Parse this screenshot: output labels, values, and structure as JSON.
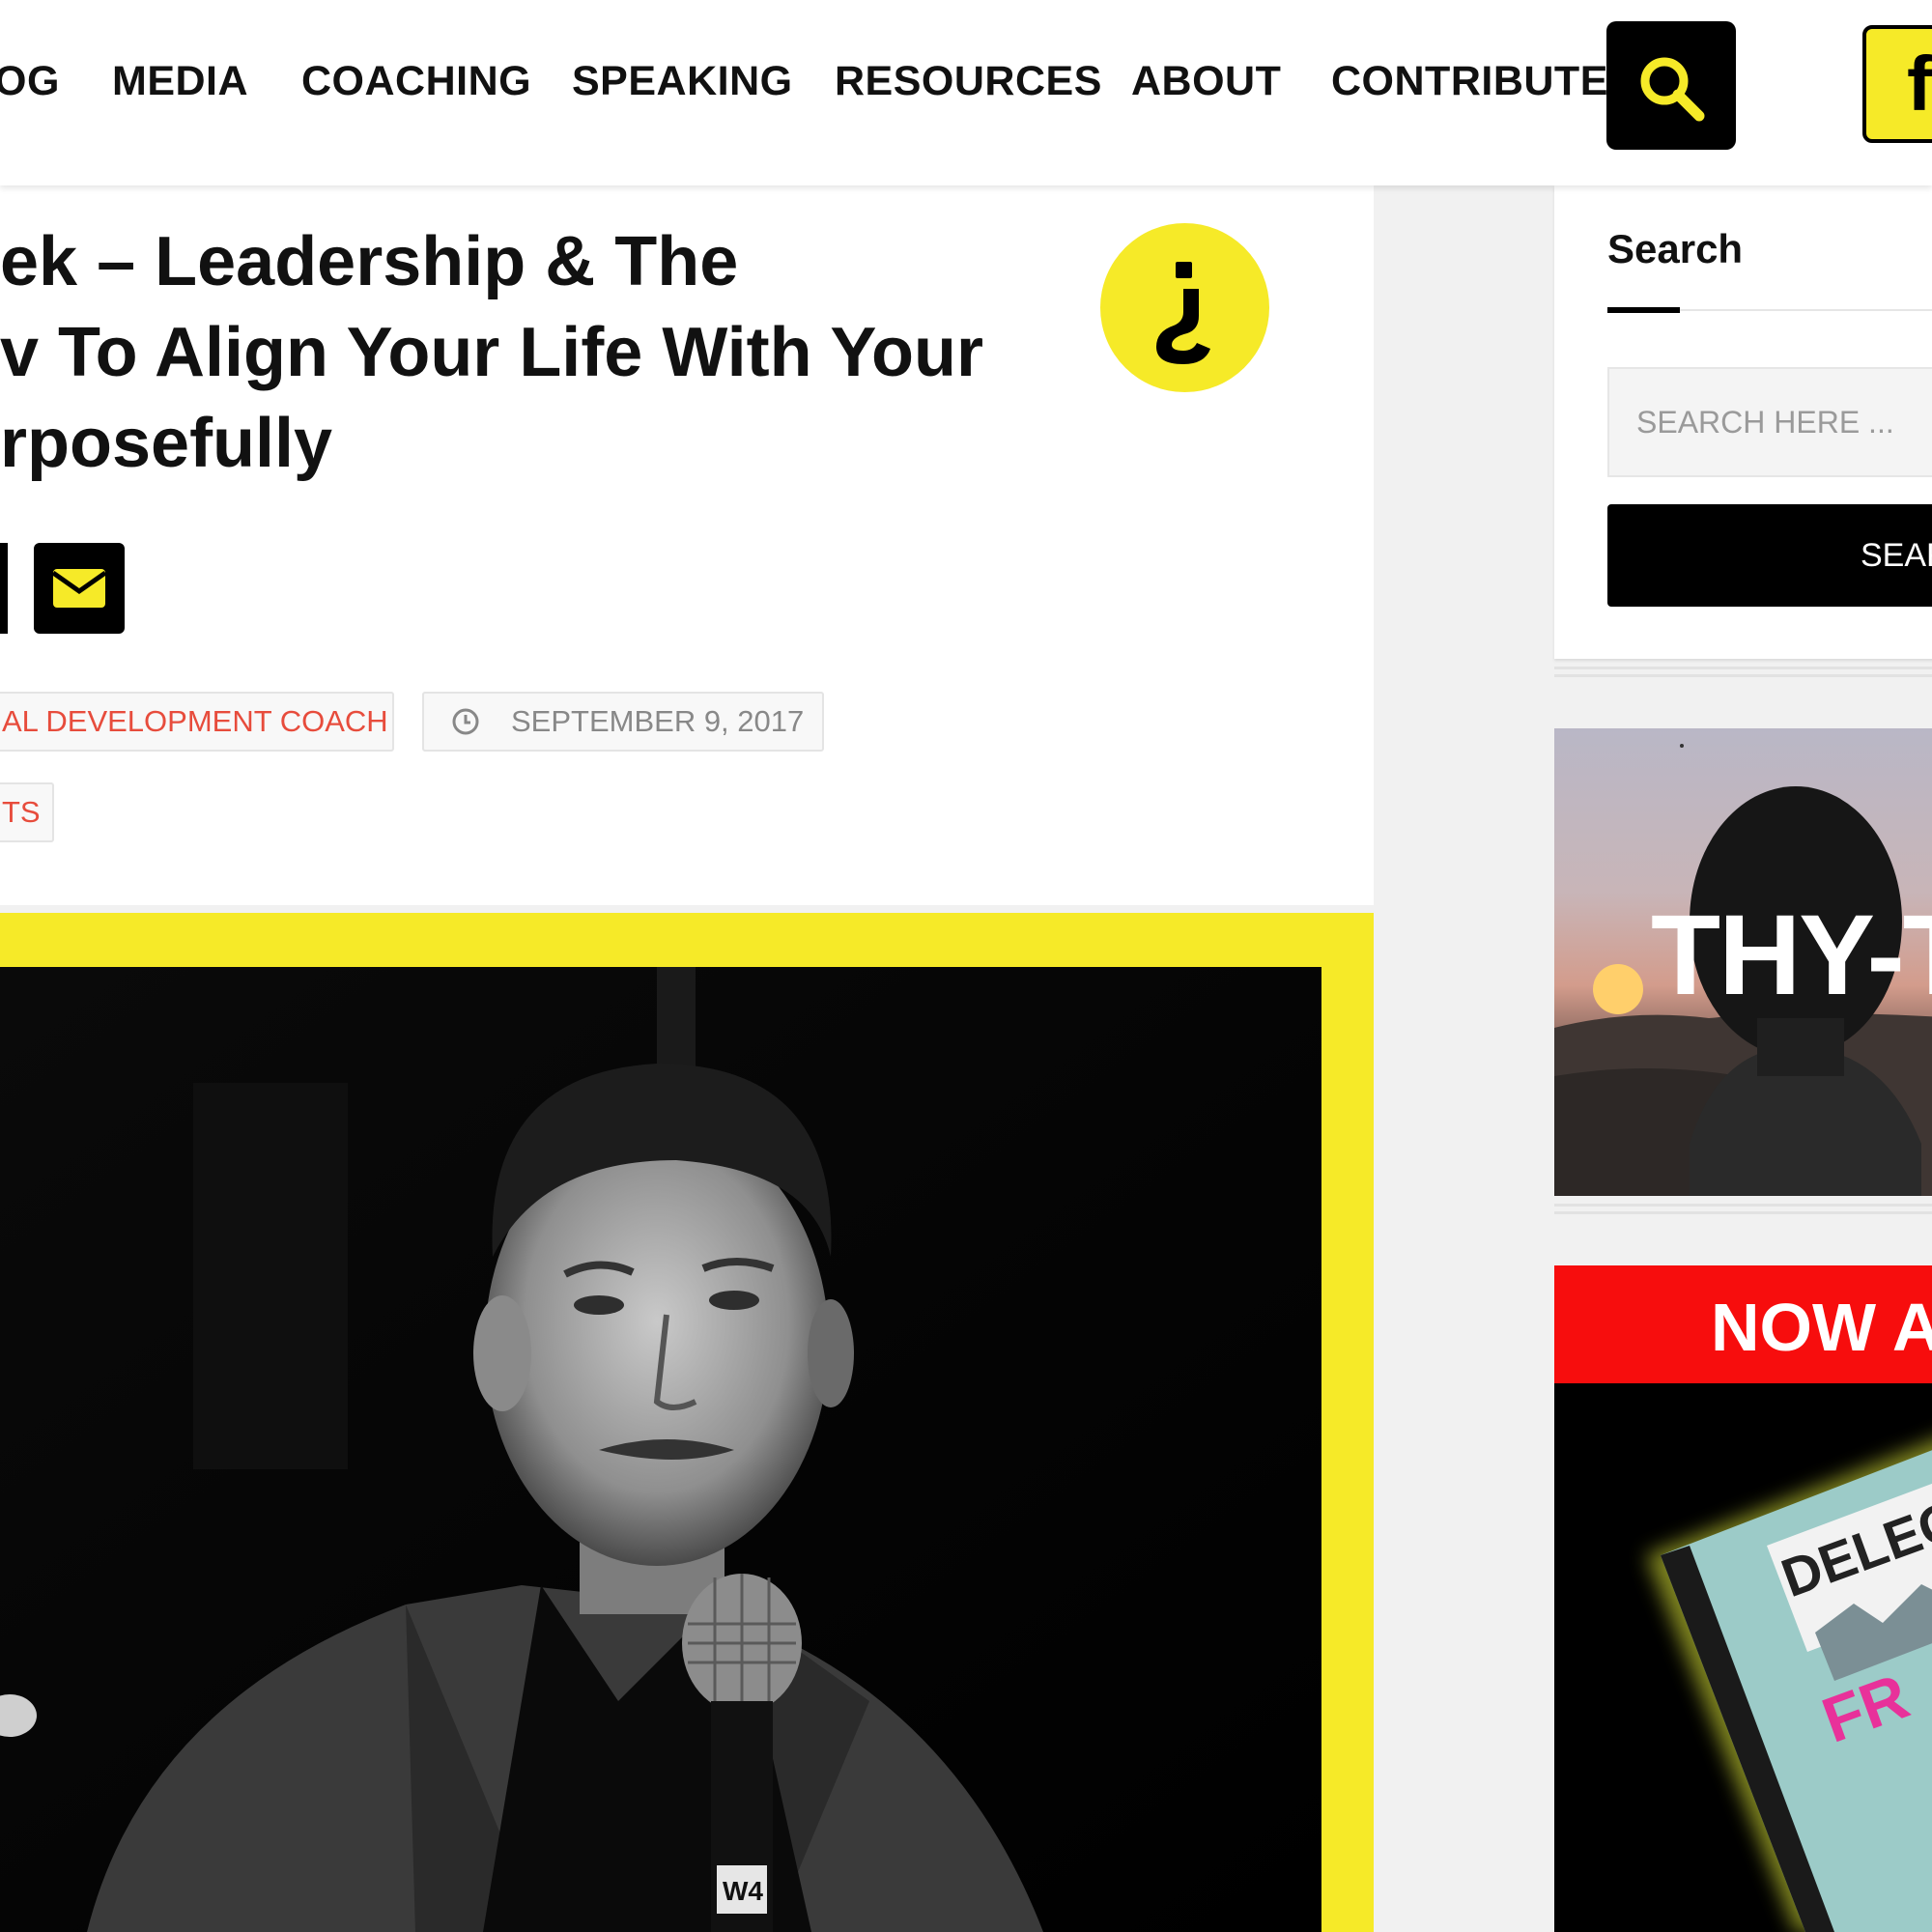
{
  "nav": {
    "items": [
      {
        "label": "OG"
      },
      {
        "label": "MEDIA"
      },
      {
        "label": "COACHING"
      },
      {
        "label": "SPEAKING"
      },
      {
        "label": "RESOURCES"
      },
      {
        "label": "ABOUT"
      },
      {
        "label": "CONTRIBUTE"
      }
    ],
    "search_icon": "search-icon",
    "social_icon": "facebook-icon"
  },
  "article": {
    "title_lines": [
      "ek – Leadership & The",
      "v To Align Your Life With Your",
      "rposefully"
    ],
    "badge_icon": "inverted-question-hook-icon",
    "share_icons": [
      "share-partial-icon",
      "email-icon"
    ],
    "category": "AL DEVELOPMENT COACH",
    "date": "SEPTEMBER 9, 2017",
    "tags": "TS",
    "photo_mic_label": "W4"
  },
  "sidebar": {
    "search_title": "Search",
    "search_placeholder": "SEARCH HERE ...",
    "search_button": "SEAF",
    "promo1_text": "THY-T",
    "promo2_banner": "NOW A",
    "promo2_book_word1": "DELEG",
    "promo2_book_word2": "FR"
  },
  "colors": {
    "accent_yellow": "#f6ea28",
    "category_red": "#e74c3c",
    "banner_red": "#f70d0d",
    "black": "#000000"
  }
}
